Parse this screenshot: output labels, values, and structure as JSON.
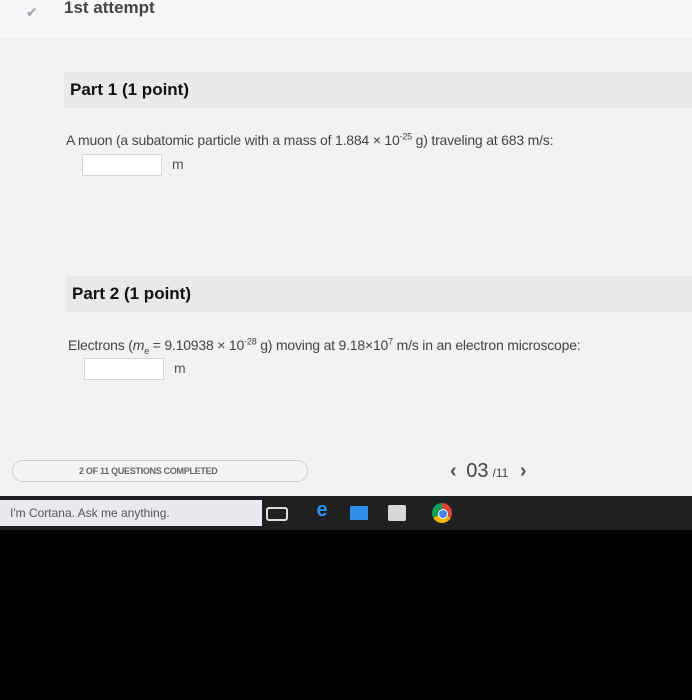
{
  "header": {
    "attempt": "1st attempt"
  },
  "part1": {
    "title": "Part 1   (1 point)",
    "question_pre": "A muon (a subatomic particle with a mass of 1.884 × 10",
    "question_exp": "-25",
    "question_post": " g) traveling at 683  m/s:",
    "answer_value": "",
    "unit": "m"
  },
  "part2": {
    "title": "Part 2   (1 point)",
    "question_a": "Electrons (",
    "question_m": "m",
    "question_sub": "e",
    "question_b": " = 9.10938 × 10",
    "question_exp": "-28",
    "question_c": " g) moving at 9.18×10",
    "question_exp2": "7",
    "question_d": "  m/s in an electron microscope:",
    "answer_value": "",
    "unit": "m"
  },
  "footer": {
    "progress_text": "2 OF 11 QUESTIONS COMPLETED",
    "prev": "‹",
    "current": "03",
    "total": "/11",
    "next": "›"
  },
  "taskbar": {
    "cortana_placeholder": "I'm Cortana. Ask me anything.",
    "icons": [
      "task-view-icon",
      "edge-icon",
      "store-icon",
      "calculator-icon",
      "chrome-icon"
    ]
  }
}
